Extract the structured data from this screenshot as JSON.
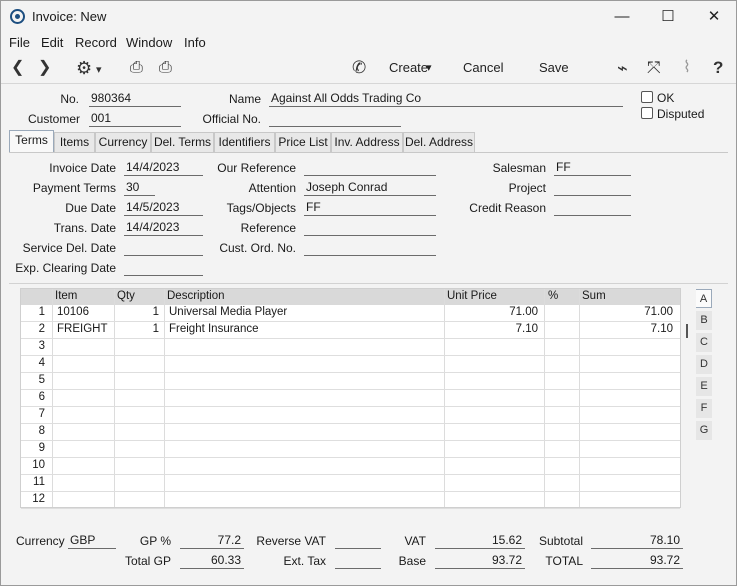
{
  "window": {
    "title": "Invoice: New",
    "minimize": "—",
    "maximize": "☐",
    "close": "✕"
  },
  "menu": [
    "File",
    "Edit",
    "Record",
    "Window",
    "Info"
  ],
  "toolbar": {
    "prev": "❮",
    "next": "❯",
    "gear": "⚙",
    "gear_caret": "▾",
    "print": "⎙",
    "preview": "⎙",
    "phone": "✆",
    "create_label": "Create",
    "create_caret": "▾",
    "cancel_label": "Cancel",
    "save_label": "Save",
    "activity": "⌁",
    "expand": "⤧",
    "attach": "⌇",
    "help": "?"
  },
  "header": {
    "no_label": "No.",
    "no_value": "980364",
    "name_label": "Name",
    "name_value": "Against All Odds Trading Co",
    "customer_label": "Customer",
    "customer_value": "001",
    "official_label": "Official No.",
    "official_value": "",
    "ok_label": "OK",
    "disputed_label": "Disputed"
  },
  "tabs": [
    "Terms",
    "Items",
    "Currency",
    "Del. Terms",
    "Identifiers",
    "Price List",
    "Inv. Address",
    "Del. Address"
  ],
  "terms": {
    "invoice_date_label": "Invoice Date",
    "invoice_date": "14/4/2023",
    "payment_terms_label": "Payment Terms",
    "payment_terms": "30",
    "due_date_label": "Due Date",
    "due_date": "14/5/2023",
    "trans_date_label": "Trans. Date",
    "trans_date": "14/4/2023",
    "service_del_label": "Service Del. Date",
    "service_del": "",
    "exp_clearing_label": "Exp. Clearing Date",
    "exp_clearing": "",
    "our_ref_label": "Our Reference",
    "our_ref": "",
    "attention_label": "Attention",
    "attention": "Joseph Conrad",
    "tags_label": "Tags/Objects",
    "tags": "FF",
    "reference_label": "Reference",
    "reference": "",
    "cust_ord_label": "Cust. Ord. No.",
    "cust_ord": "",
    "salesman_label": "Salesman",
    "salesman": "FF",
    "project_label": "Project",
    "project": "",
    "credit_reason_label": "Credit Reason",
    "credit_reason": ""
  },
  "grid": {
    "columns": [
      "Item",
      "Qty",
      "Description",
      "Unit Price",
      "%",
      "Sum"
    ],
    "rows": [
      {
        "n": "1",
        "item": "10106",
        "qty": "1",
        "desc": "Universal Media Player",
        "price": "71.00",
        "pct": "",
        "sum": "71.00"
      },
      {
        "n": "2",
        "item": "FREIGHT",
        "qty": "1",
        "desc": "Freight Insurance",
        "price": "7.10",
        "pct": "",
        "sum": "7.10"
      },
      {
        "n": "3",
        "item": "",
        "qty": "",
        "desc": "",
        "price": "",
        "pct": "",
        "sum": ""
      },
      {
        "n": "4",
        "item": "",
        "qty": "",
        "desc": "",
        "price": "",
        "pct": "",
        "sum": ""
      },
      {
        "n": "5",
        "item": "",
        "qty": "",
        "desc": "",
        "price": "",
        "pct": "",
        "sum": ""
      },
      {
        "n": "6",
        "item": "",
        "qty": "",
        "desc": "",
        "price": "",
        "pct": "",
        "sum": ""
      },
      {
        "n": "7",
        "item": "",
        "qty": "",
        "desc": "",
        "price": "",
        "pct": "",
        "sum": ""
      },
      {
        "n": "8",
        "item": "",
        "qty": "",
        "desc": "",
        "price": "",
        "pct": "",
        "sum": ""
      },
      {
        "n": "9",
        "item": "",
        "qty": "",
        "desc": "",
        "price": "",
        "pct": "",
        "sum": ""
      },
      {
        "n": "10",
        "item": "",
        "qty": "",
        "desc": "",
        "price": "",
        "pct": "",
        "sum": ""
      },
      {
        "n": "11",
        "item": "",
        "qty": "",
        "desc": "",
        "price": "",
        "pct": "",
        "sum": ""
      },
      {
        "n": "12",
        "item": "",
        "qty": "",
        "desc": "",
        "price": "",
        "pct": "",
        "sum": ""
      }
    ],
    "side_tabs": [
      "A",
      "B",
      "C",
      "D",
      "E",
      "F",
      "G"
    ]
  },
  "footer": {
    "currency_label": "Currency",
    "currency": "GBP",
    "gp_pct_label": "GP %",
    "gp_pct": "77.2",
    "total_gp_label": "Total GP",
    "total_gp": "60.33",
    "reverse_vat_label": "Reverse VAT",
    "reverse_vat": "",
    "ext_tax_label": "Ext. Tax",
    "ext_tax": "",
    "vat_label": "VAT",
    "vat": "15.62",
    "base_label": "Base",
    "base": "93.72",
    "subtotal_label": "Subtotal",
    "subtotal": "78.10",
    "total_label": "TOTAL",
    "total": "93.72"
  }
}
